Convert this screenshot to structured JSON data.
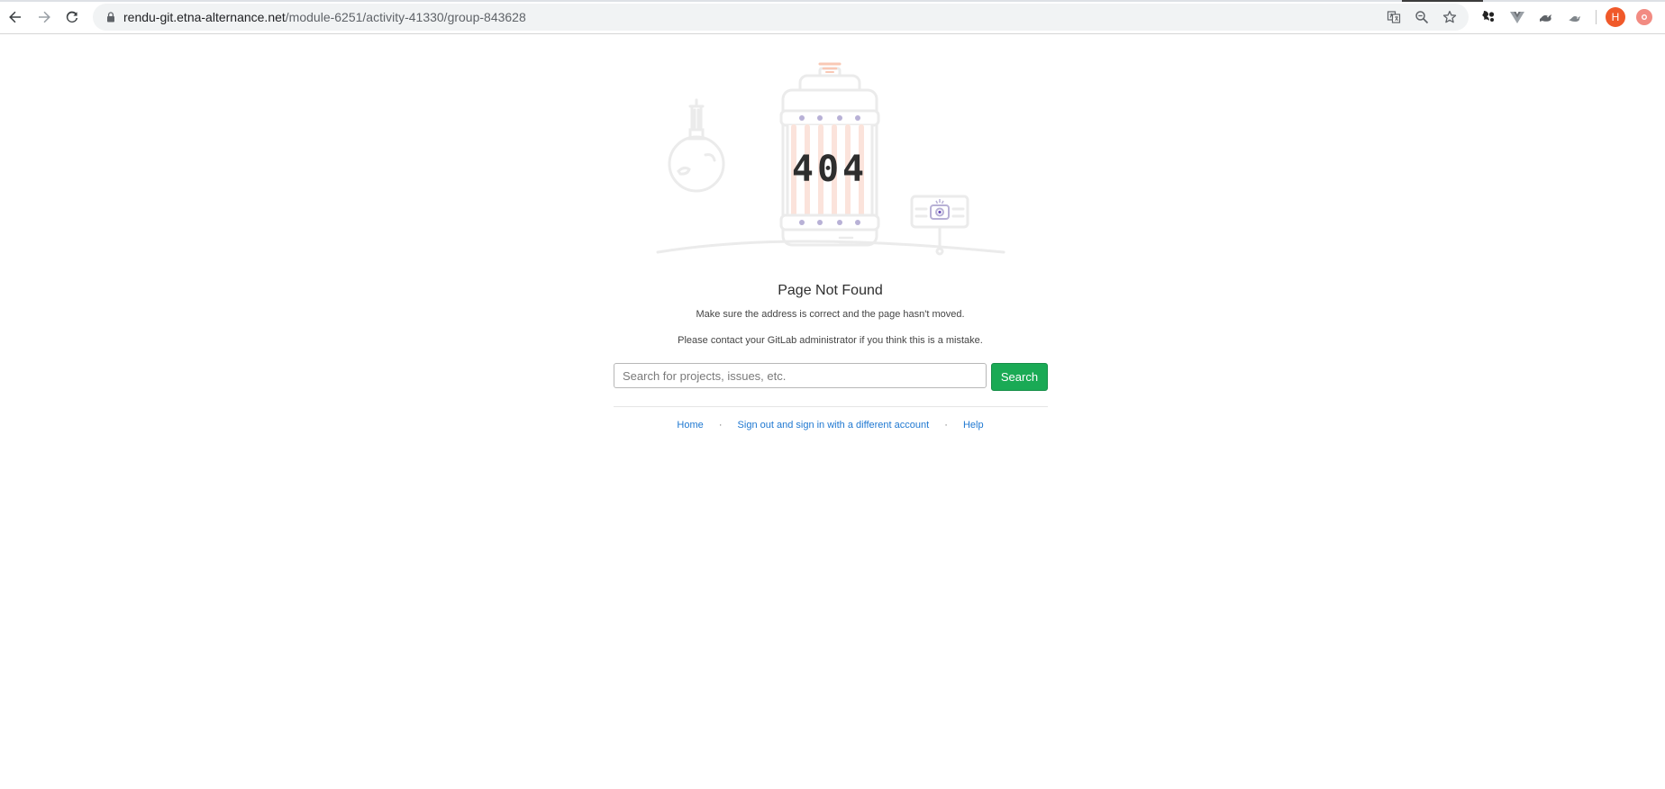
{
  "browser": {
    "url_host": "rendu-git.etna-alternance.net",
    "url_path": "/module-6251/activity-41330/group-843628",
    "avatar_letter": "H",
    "accent_color": "#f0592a"
  },
  "page": {
    "illustration_text": "404",
    "title": "Page Not Found",
    "message_1": "Make sure the address is correct and the page hasn't moved.",
    "message_2": "Please contact your GitLab administrator if you think this is a mistake.",
    "search_placeholder": "Search for projects, issues, etc.",
    "search_button": "Search",
    "search_button_color": "#1aaa55"
  },
  "footer": {
    "links": {
      "home": "Home",
      "sign_out": "Sign out and sign in with a different account",
      "help": "Help"
    },
    "separator": "·"
  },
  "icons": {
    "back": "arrow-left-icon",
    "forward": "arrow-right-icon",
    "reload": "reload-icon",
    "lock": "lock-icon",
    "translate": "translate-icon",
    "zoom": "zoom-out-icon",
    "bookmark": "star-icon",
    "extensions": [
      "extension-gnome-icon",
      "extension-vue-icon",
      "extension-bird-icon",
      "extension-bird-2-icon"
    ],
    "record": "record-icon"
  }
}
